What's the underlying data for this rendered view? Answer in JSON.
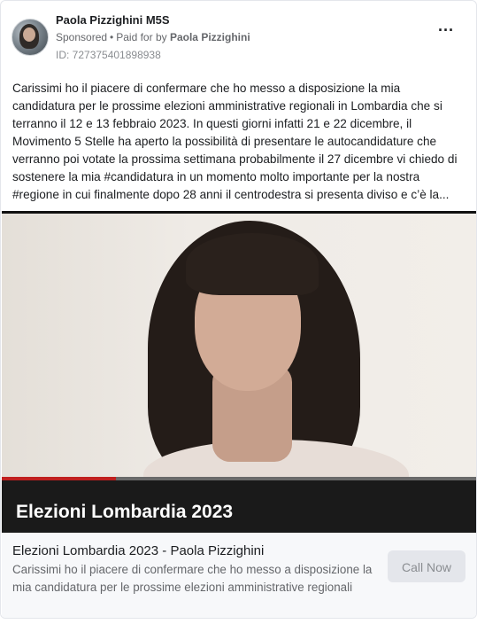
{
  "post": {
    "page_name": "Paola Pizzighini M5S",
    "sponsored_label": "Sponsored",
    "paid_for_prefix": "Paid for by",
    "paid_for_name": "Paola Pizzighini",
    "ad_id": "ID: 727375401898938",
    "more_icon": "more-horizontal-icon",
    "body": "Carissimi ho il piacere di confermare che ho messo a disposizione la mia candidatura per le prossime elezioni amministrative regionali in Lombardia che si terranno il 12 e 13 febbraio 2023. In questi giorni infatti 21 e 22 dicembre, il Movimento 5 Stelle ha aperto la possibilità di presentare le autocandidature che verranno poi votate la prossima settimana probabilmente il 27 dicembre vi chiedo di sostenere la mia #candidatura in un momento molto importante per la nostra #regione in cui finalmente dopo 28 anni il centrodestra si presenta diviso e c’è la..."
  },
  "video": {
    "overlay_title": "Elezioni Lombardia 2023",
    "progress": 0.24,
    "progress_color": "#c0201f"
  },
  "footer": {
    "headline": "Elezioni Lombardia 2023 - Paola Pizzighini",
    "description": "Carissimi ho il piacere di confermare che ho messo a disposizione la mia candidatura per le prossime elezioni amministrative regionali",
    "cta_label": "Call Now"
  }
}
